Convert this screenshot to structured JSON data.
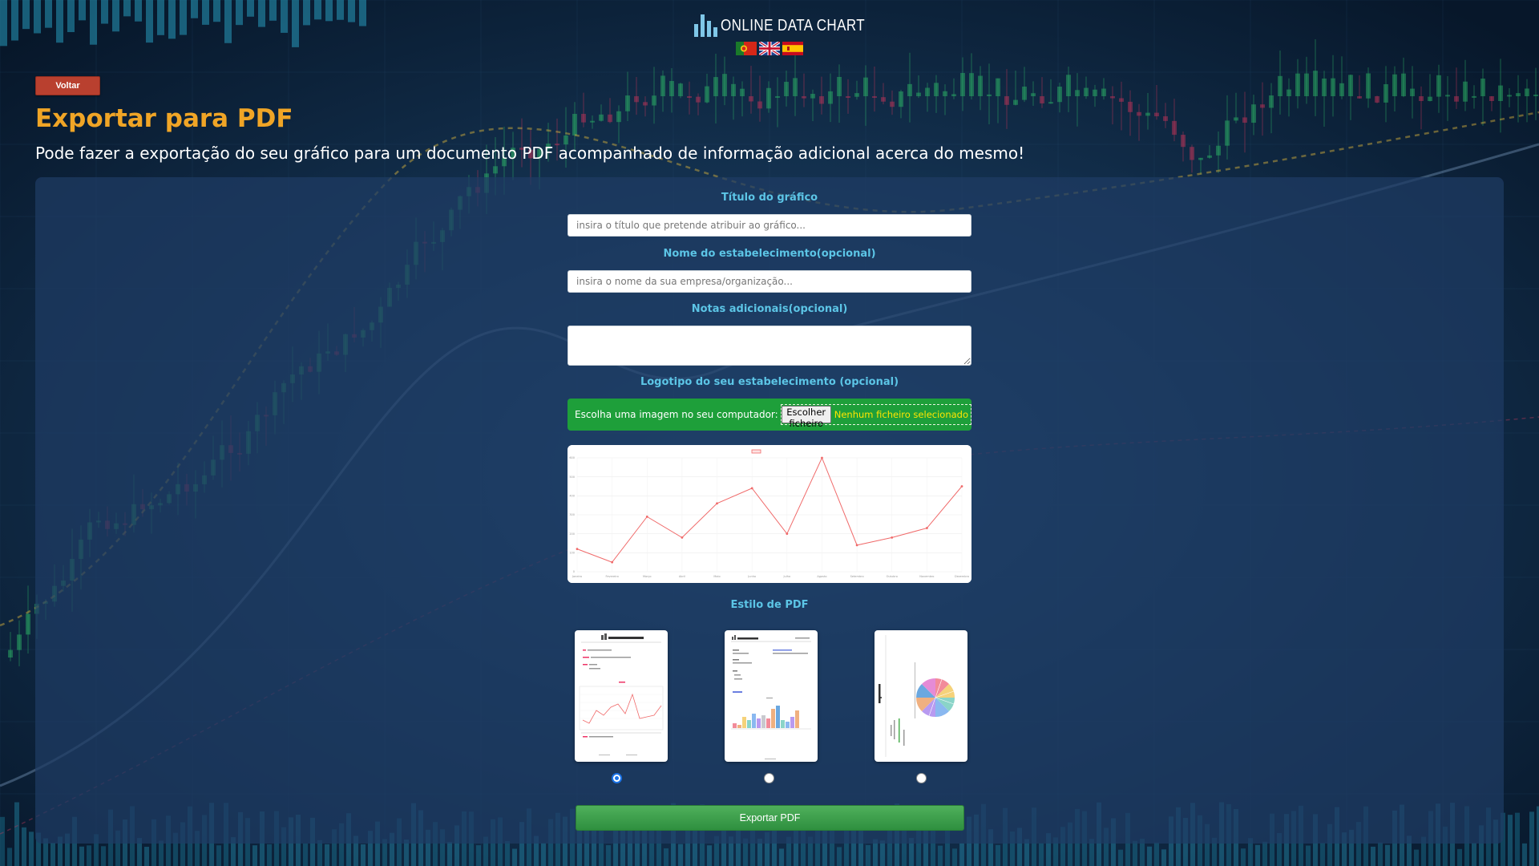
{
  "header": {
    "logo_text": "ONLINE DATA CHART",
    "flags": [
      "Português",
      "English",
      "Español"
    ]
  },
  "nav": {
    "back_label": "Voltar"
  },
  "page": {
    "title": "Exportar para PDF",
    "subtitle": "Pode fazer a exportação do seu gráfico para um documento PDF acompanhado de informação adicional acerca do mesmo!"
  },
  "form": {
    "chart_title_label": "Título do gráfico",
    "chart_title_placeholder": "insira o título que pretende atribuir ao gráfico...",
    "chart_title_value": "",
    "org_name_label": "Nome do estabelecimento(opcional)",
    "org_name_placeholder": "insira o nome da sua empresa/organização...",
    "org_name_value": "",
    "notes_label": "Notas adicionais(opcional)",
    "notes_value": "",
    "logo_label": "Logotipo do seu estabelecimento (opcional)",
    "logo_prompt": "Escolha uma imagem no seu computador:",
    "logo_button": "Escolher ficheiro",
    "logo_status": "Nenhum ficheiro selecionado",
    "pdf_style_label": "Estilo de PDF",
    "pdf_styles": [
      {
        "selected": true
      },
      {
        "selected": false
      },
      {
        "selected": false
      }
    ],
    "export_label": "Exportar PDF"
  },
  "chart_data": {
    "type": "line",
    "title": "",
    "categories": [
      "Janeiro",
      "Fevereiro",
      "Março",
      "Abril",
      "Maio",
      "Junho",
      "Julho",
      "Agosto",
      "Setembro",
      "Outubro",
      "Novembro",
      "Dezembro"
    ],
    "series": [
      {
        "name": "",
        "color": "#f06a6a",
        "values": [
          120,
          50,
          290,
          180,
          360,
          440,
          200,
          600,
          140,
          180,
          230,
          450
        ]
      }
    ],
    "ylim": [
      0,
      600
    ],
    "yticks": [
      0,
      100,
      200,
      300,
      400,
      500,
      600
    ],
    "grid": true,
    "legend": "top"
  },
  "colors": {
    "accent_title": "#f0a526",
    "label": "#5cc5e6",
    "file_box": "#1e9f3a",
    "file_status": "#ffe500",
    "back_button": "#b9402f",
    "export_button": "#3aa24c"
  }
}
